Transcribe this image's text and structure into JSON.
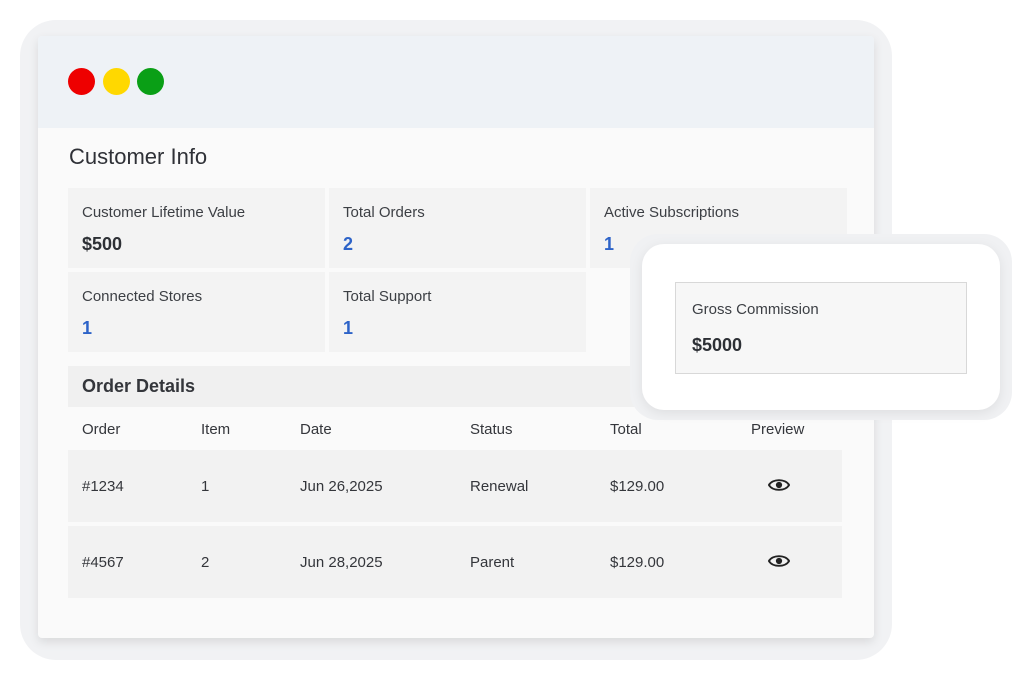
{
  "window": {
    "controls": [
      "close",
      "minimize",
      "maximize"
    ]
  },
  "customer_info": {
    "title": "Customer Info",
    "cards": [
      {
        "label": "Customer Lifetime Value",
        "value": "$500"
      },
      {
        "label": "Total Orders",
        "value": "2"
      },
      {
        "label": "Active Subscriptions",
        "value": "1"
      },
      {
        "label": "Connected Stores",
        "value": "1"
      },
      {
        "label": "Total Support",
        "value": "1"
      }
    ]
  },
  "gross_commission": {
    "label": "Gross Commission",
    "value": "$5000"
  },
  "order_details": {
    "title": "Order Details",
    "columns": [
      "Order",
      "Item",
      "Date",
      "Status",
      "Total",
      "Preview"
    ],
    "rows": [
      {
        "order": "#1234",
        "item": "1",
        "date": "Jun 26,2025",
        "status": "Renewal",
        "total": "$129.00",
        "preview_icon": "eye-icon"
      },
      {
        "order": "#4567",
        "item": "2",
        "date": "Jun 28,2025",
        "status": "Parent",
        "total": "$129.00",
        "preview_icon": "eye-icon"
      }
    ]
  },
  "colors": {
    "close": "#ee0000",
    "minimize": "#ffd800",
    "maximize": "#0a9f16",
    "link_value": "#2d63c8"
  }
}
